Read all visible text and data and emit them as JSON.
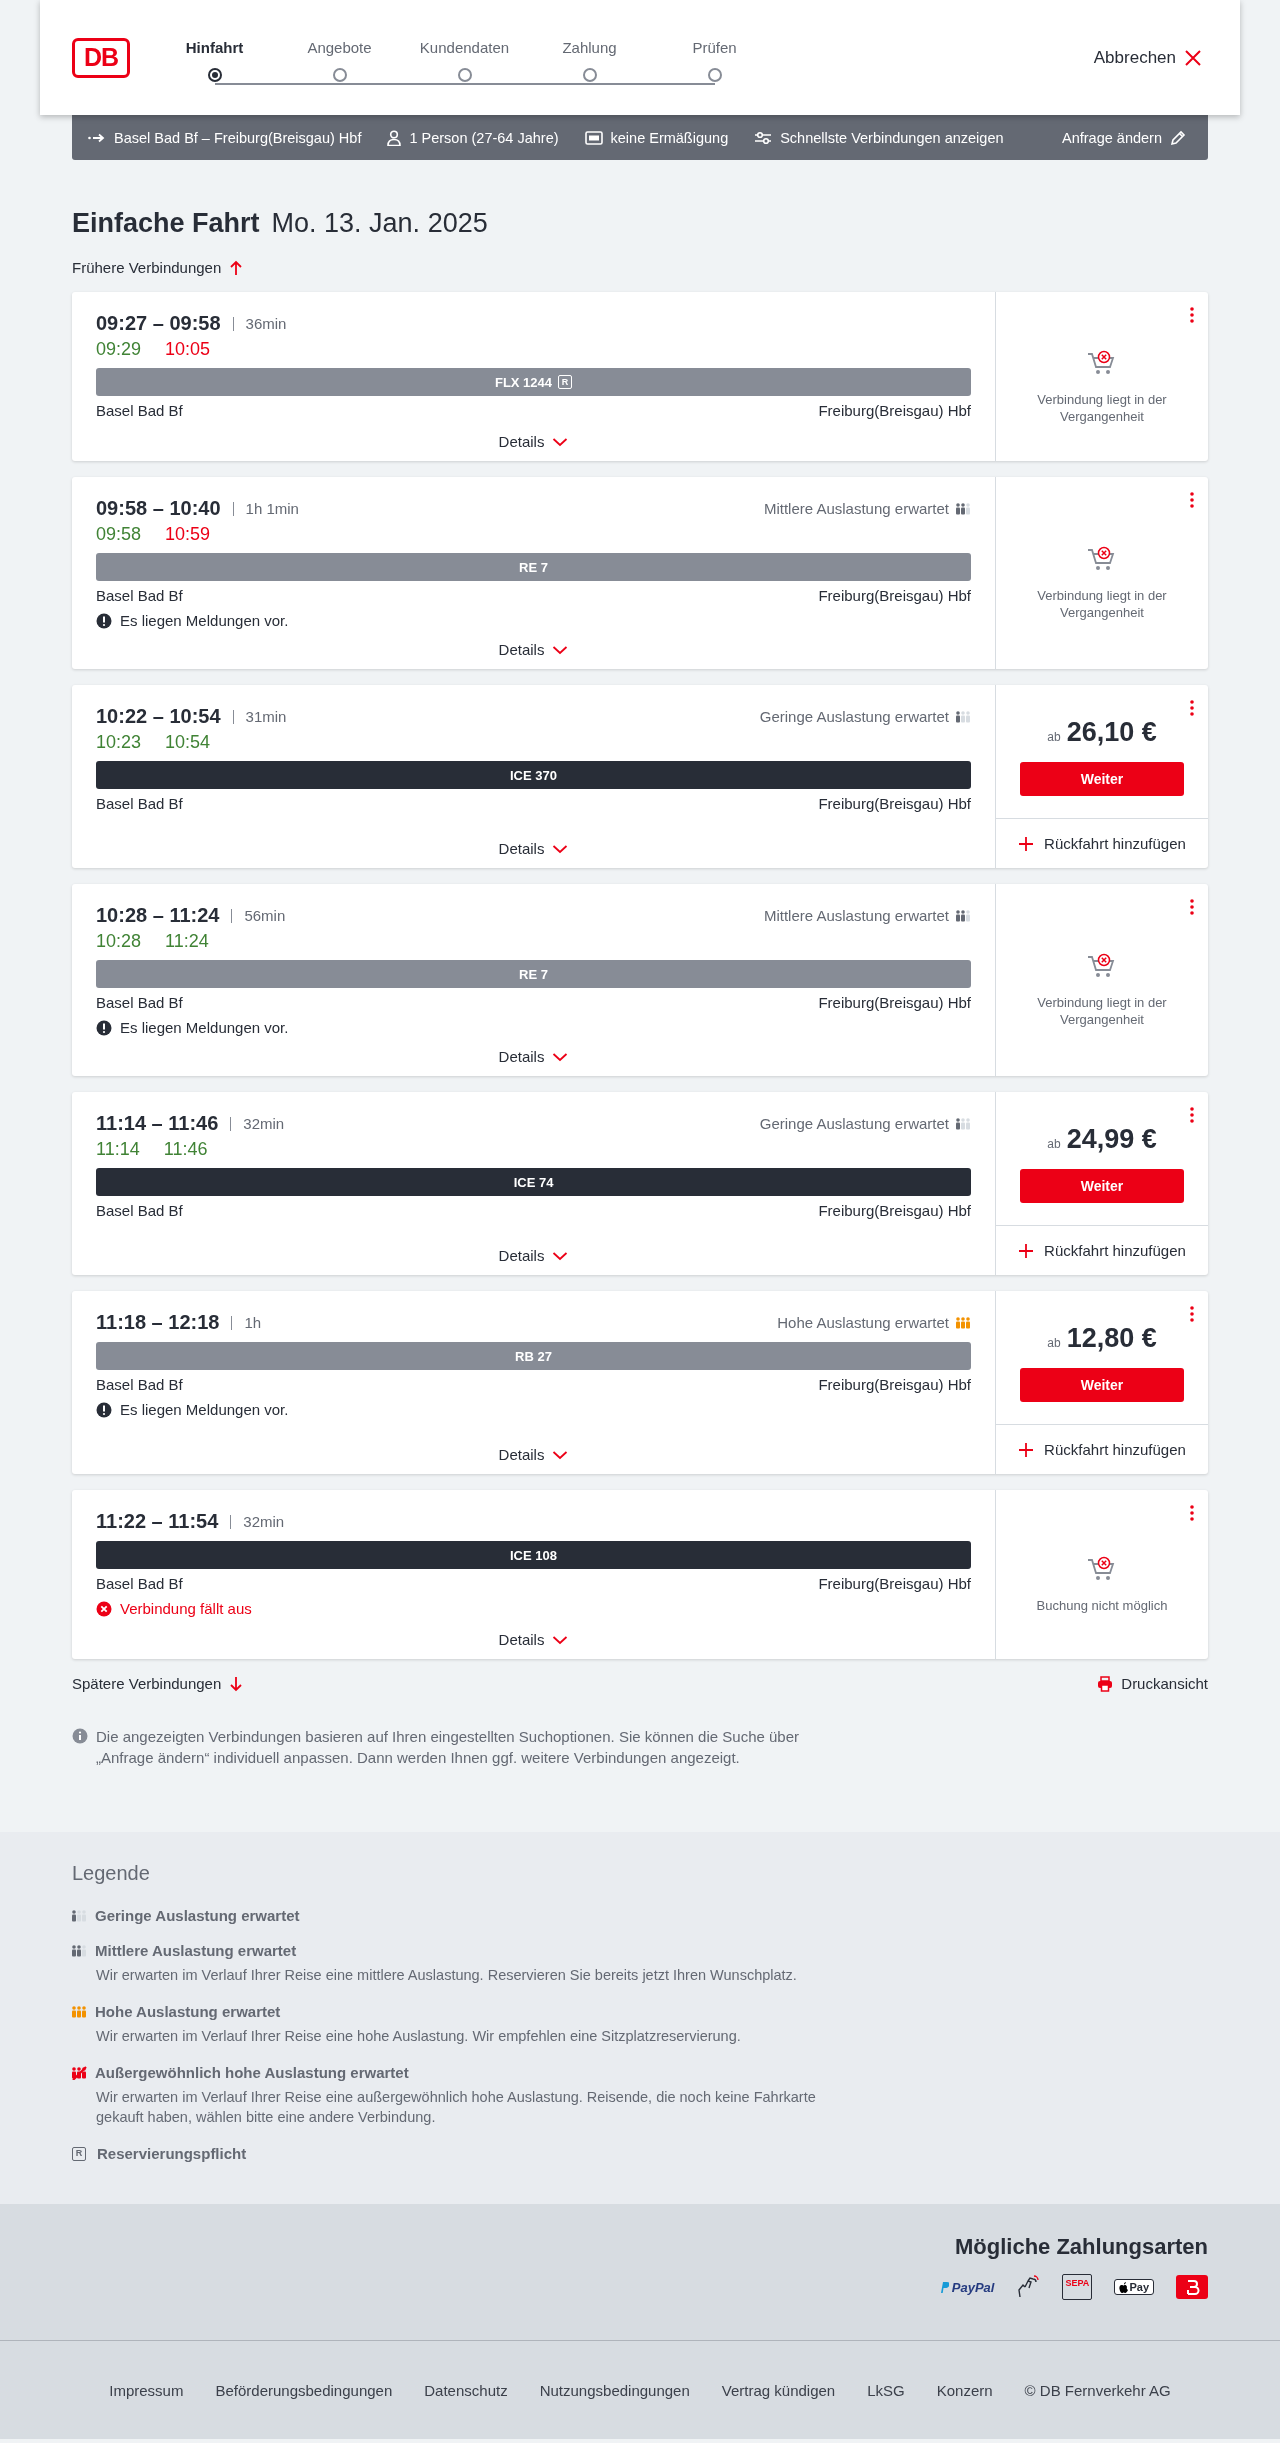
{
  "header": {
    "logo": "DB",
    "steps": [
      {
        "label": "Hinfahrt",
        "selected": true
      },
      {
        "label": "Angebote",
        "selected": false
      },
      {
        "label": "Kundendaten",
        "selected": false
      },
      {
        "label": "Zahlung",
        "selected": false
      },
      {
        "label": "Prüfen",
        "selected": false
      }
    ],
    "cancel": "Abbrechen"
  },
  "search_bar": {
    "route": "Basel Bad Bf – Freiburg(Breisgau) Hbf",
    "passengers": "1 Person (27-64 Jahre)",
    "discount": "keine Ermäßigung",
    "option": "Schnellste Verbindungen anzeigen",
    "edit": "Anfrage ändern"
  },
  "title": "Einfache Fahrt",
  "date": "Mo. 13. Jan. 2025",
  "earlier": "Frühere Verbindungen",
  "connections": [
    {
      "times": "09:27 – 09:58",
      "duration": "36min",
      "realtime": [
        {
          "time": "09:29",
          "delayed": false
        },
        {
          "time": "10:05",
          "delayed": true
        }
      ],
      "train": {
        "name": "FLX 1244",
        "kind": "regional",
        "reservation": "R"
      },
      "from": "Basel Bad Bf",
      "to": "Freiburg(Breisgau) Hbf",
      "details": "Details",
      "offer": {
        "kind": "past",
        "text": "Verbindung liegt in der Vergangenheit"
      }
    },
    {
      "times": "09:58 – 10:40",
      "duration": "1h 1min",
      "occupancy": {
        "kind": "medium",
        "text": "Mittlere Auslastung erwartet"
      },
      "realtime": [
        {
          "time": "09:58",
          "delayed": false
        },
        {
          "time": "10:59",
          "delayed": true
        }
      ],
      "train": {
        "name": "RE 7",
        "kind": "regional"
      },
      "from": "Basel Bad Bf",
      "to": "Freiburg(Breisgau) Hbf",
      "message": {
        "kind": "info",
        "text": "Es liegen Meldungen vor."
      },
      "details": "Details",
      "offer": {
        "kind": "past",
        "text": "Verbindung liegt in der Vergangenheit"
      }
    },
    {
      "times": "10:22 – 10:54",
      "duration": "31min",
      "occupancy": {
        "kind": "low",
        "text": "Geringe Auslastung erwartet"
      },
      "realtime": [
        {
          "time": "10:23",
          "delayed": false
        },
        {
          "time": "10:54",
          "delayed": false
        }
      ],
      "train": {
        "name": "ICE 370",
        "kind": "long_distance"
      },
      "from": "Basel Bad Bf",
      "to": "Freiburg(Breisgau) Hbf",
      "details": "Details",
      "offer": {
        "kind": "price",
        "prefix": "ab",
        "price": "26,10 €",
        "button": "Weiter",
        "return": "Rückfahrt hinzufügen"
      }
    },
    {
      "times": "10:28 – 11:24",
      "duration": "56min",
      "occupancy": {
        "kind": "medium",
        "text": "Mittlere Auslastung erwartet"
      },
      "realtime": [
        {
          "time": "10:28",
          "delayed": false
        },
        {
          "time": "11:24",
          "delayed": false
        }
      ],
      "train": {
        "name": "RE 7",
        "kind": "regional"
      },
      "from": "Basel Bad Bf",
      "to": "Freiburg(Breisgau) Hbf",
      "message": {
        "kind": "info",
        "text": "Es liegen Meldungen vor."
      },
      "details": "Details",
      "offer": {
        "kind": "past",
        "text": "Verbindung liegt in der Vergangenheit"
      }
    },
    {
      "times": "11:14 – 11:46",
      "duration": "32min",
      "occupancy": {
        "kind": "low",
        "text": "Geringe Auslastung erwartet"
      },
      "realtime": [
        {
          "time": "11:14",
          "delayed": false
        },
        {
          "time": "11:46",
          "delayed": false
        }
      ],
      "train": {
        "name": "ICE 74",
        "kind": "long_distance"
      },
      "from": "Basel Bad Bf",
      "to": "Freiburg(Breisgau) Hbf",
      "details": "Details",
      "offer": {
        "kind": "price",
        "prefix": "ab",
        "price": "24,99 €",
        "button": "Weiter",
        "return": "Rückfahrt hinzufügen"
      }
    },
    {
      "times": "11:18 – 12:18",
      "duration": "1h",
      "occupancy": {
        "kind": "high",
        "text": "Hohe Auslastung erwartet"
      },
      "train": {
        "name": "RB 27",
        "kind": "regional"
      },
      "from": "Basel Bad Bf",
      "to": "Freiburg(Breisgau) Hbf",
      "message": {
        "kind": "info",
        "text": "Es liegen Meldungen vor."
      },
      "details": "Details",
      "offer": {
        "kind": "price",
        "prefix": "ab",
        "price": "12,80 €",
        "button": "Weiter",
        "return": "Rückfahrt hinzufügen"
      }
    },
    {
      "times": "11:22 – 11:54",
      "duration": "32min",
      "train": {
        "name": "ICE 108",
        "kind": "long_distance"
      },
      "from": "Basel Bad Bf",
      "to": "Freiburg(Breisgau) Hbf",
      "message": {
        "kind": "cancelled",
        "text": "Verbindung fällt aus"
      },
      "details": "Details",
      "offer": {
        "kind": "unavailable",
        "text": "Buchung nicht möglich"
      }
    }
  ],
  "later": "Spätere Verbindungen",
  "print": "Druckansicht",
  "note": "Die angezeigten Verbindungen basieren auf Ihren eingestellten Suchoptionen. Sie können die Suche über „Anfrage ändern“ individuell anpassen. Dann werden Ihnen ggf. weitere Verbindungen angezeigt.",
  "legend": {
    "title": "Legende",
    "items": [
      {
        "kind": "low",
        "title": "Geringe Auslastung erwartet"
      },
      {
        "kind": "medium",
        "title": "Mittlere Auslastung erwartet",
        "text": "Wir erwarten im Verlauf Ihrer Reise eine mittlere Auslastung. Reservieren Sie bereits jetzt Ihren Wunschplatz."
      },
      {
        "kind": "high",
        "title": "Hohe Auslastung erwartet",
        "text": "Wir erwarten im Verlauf Ihrer Reise eine hohe Auslastung. Wir empfehlen eine Sitzplatzreservierung."
      },
      {
        "kind": "extreme",
        "title": "Außergewöhnlich hohe Auslastung erwartet",
        "text": "Wir erwarten im Verlauf Ihrer Reise eine außergewöhnlich hohe Auslastung. Reisende, die noch keine Fahrkarte gekauft haben, wählen bitte eine andere Verbindung."
      },
      {
        "kind": "reservation",
        "title": "Reservierungspflicht",
        "mark": "R"
      }
    ]
  },
  "payment": {
    "title": "Mögliche Zahlungsarten",
    "methods": [
      {
        "kind": "paypal",
        "label": "PayPal"
      },
      {
        "kind": "contactless"
      },
      {
        "kind": "sepa",
        "label": "SEPA"
      },
      {
        "kind": "applepay",
        "label": "Pay"
      },
      {
        "kind": "dbcard"
      }
    ]
  },
  "footer_links": [
    "Impressum",
    "Beförderungsbedingungen",
    "Datenschutz",
    "Nutzungsbedingungen",
    "Vertrag kündigen",
    "LkSG",
    "Konzern",
    "© DB Fernverkehr AG"
  ]
}
